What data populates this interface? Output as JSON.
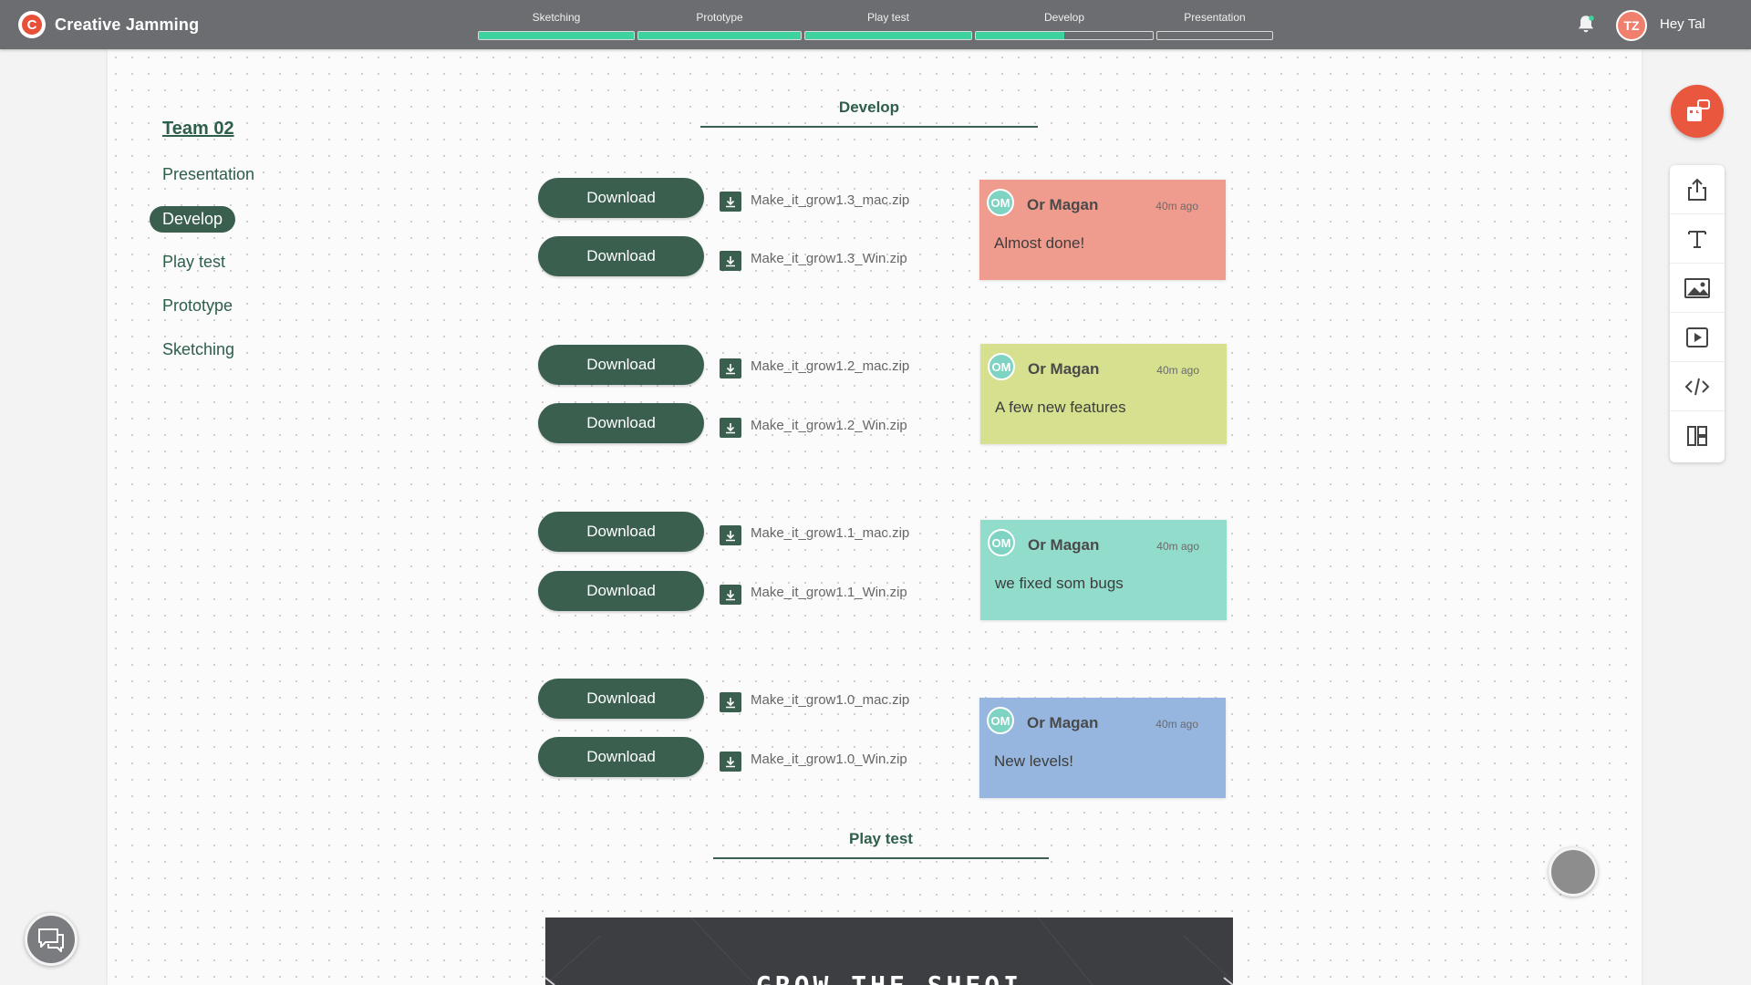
{
  "app": {
    "name": "Creative Jamming",
    "logo_letter": "C",
    "accent": "#e9573f",
    "brand_green": "#3a5f4e"
  },
  "steps": [
    {
      "label": "Sketching",
      "progress": 1.0
    },
    {
      "label": "Prototype",
      "progress": 1.0
    },
    {
      "label": "Play test",
      "progress": 1.0
    },
    {
      "label": "Develop",
      "progress": 0.5
    },
    {
      "label": "Presentation",
      "progress": 0.0
    }
  ],
  "user": {
    "initials": "TZ",
    "greeting": "Hey Tal"
  },
  "sidebar": {
    "team": "Team 02",
    "items": [
      "Presentation",
      "Develop",
      "Play test",
      "Prototype",
      "Sketching"
    ],
    "active": "Develop"
  },
  "sections": {
    "develop": "Develop",
    "playtest": "Play test"
  },
  "downloads": [
    {
      "button": "Download",
      "file": "Make_it_grow1.3_mac.zip"
    },
    {
      "button": "Download",
      "file": "Make_it_grow1.3_Win.zip"
    },
    {
      "button": "Download",
      "file": "Make_it_grow1.2_mac.zip"
    },
    {
      "button": "Download",
      "file": "Make_it_grow1.2_Win.zip"
    },
    {
      "button": "Download",
      "file": "Make_it_grow1.1_mac.zip"
    },
    {
      "button": "Download",
      "file": "Make_it_grow1.1_Win.zip"
    },
    {
      "button": "Download",
      "file": "Make_it_grow1.0_mac.zip"
    },
    {
      "button": "Download",
      "file": "Make_it_grow1.0_Win.zip"
    }
  ],
  "notes": [
    {
      "initials": "OM",
      "author": "Or Magan",
      "time": "40m ago",
      "message": "Almost done!",
      "color": "#ef9c8e"
    },
    {
      "initials": "OM",
      "author": "Or Magan",
      "time": "40m ago",
      "message": "A few new features",
      "color": "#d6e08e"
    },
    {
      "initials": "OM",
      "author": "Or Magan",
      "time": "40m ago",
      "message": "we fixed som bugs",
      "color": "#92dccc"
    },
    {
      "initials": "OM",
      "author": "Or Magan",
      "time": "40m ago",
      "message": "New levels!",
      "color": "#97b6df"
    }
  ],
  "tools": [
    "share-icon",
    "text-icon",
    "image-icon",
    "video-icon",
    "code-icon",
    "layout-icon"
  ],
  "preview": {
    "title": "GROW THE SHEOI"
  }
}
